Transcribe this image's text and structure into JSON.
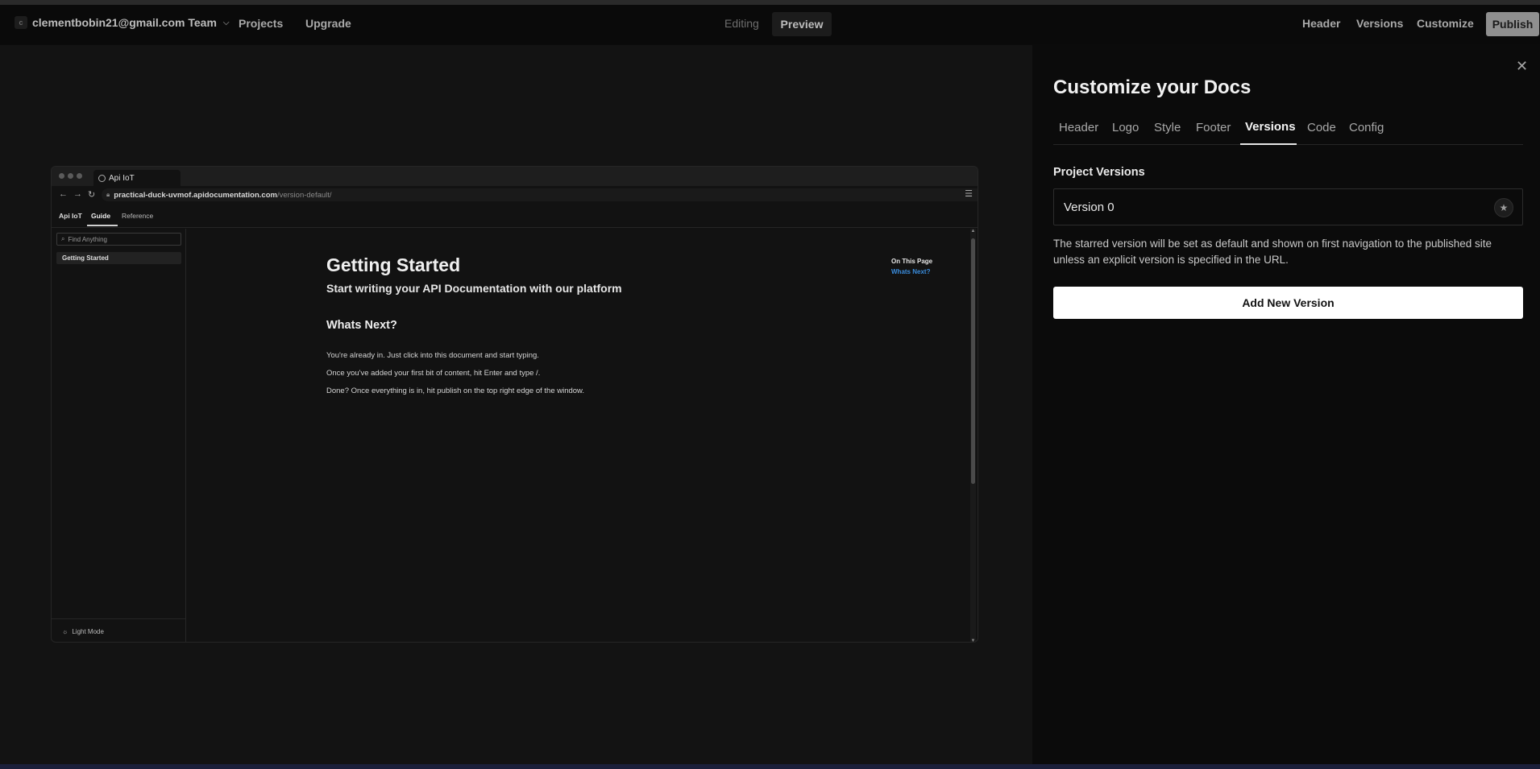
{
  "topbar": {
    "team_avatar": "c",
    "team_name": "clementbobin21@gmail.com Team",
    "nav": [
      "Projects",
      "Upgrade"
    ],
    "mode_editing": "Editing",
    "mode_preview": "Preview",
    "right_links": [
      "Header",
      "Versions",
      "Customize"
    ],
    "publish_label": "Publish"
  },
  "preview": {
    "tab_title": "Api IoT",
    "url_host": "practical-duck-uvmof.apidocumentation.com",
    "url_path": "/version-default/",
    "nav_brand": "Api IoT",
    "nav_guide": "Guide",
    "nav_reference": "Reference",
    "search_placeholder": "Find Anything",
    "sidebar_item": "Getting Started",
    "light_mode": "Light Mode",
    "doc": {
      "title": "Getting Started",
      "subtitle": "Start writing your API Documentation with our platform",
      "section_heading": "Whats Next?",
      "paragraphs": [
        "You're already in. Just click into this document and start typing.",
        "Once you've added your first bit of content, hit Enter and type /.",
        "Done? Once everything is in, hit publish on the top right edge of the window."
      ]
    },
    "on_this_page_title": "On This Page",
    "on_this_page_link": "Whats Next?"
  },
  "panel": {
    "title": "Customize your Docs",
    "tabs": [
      "Header",
      "Logo",
      "Style",
      "Footer",
      "Versions",
      "Code",
      "Config"
    ],
    "active_tab": "Versions",
    "section_label": "Project Versions",
    "versions": [
      {
        "name": "Version 0",
        "starred": true
      }
    ],
    "description": "The starred version will be set as default and shown on first navigation to the published site unless an explicit version is specified in the URL.",
    "add_button": "Add New Version"
  },
  "colors": {
    "background": "#0b0b0b",
    "overlay": "#131313",
    "link_blue": "#3a8dde",
    "publish_bg": "#8f8f8f",
    "add_button_bg": "#ffffff"
  }
}
